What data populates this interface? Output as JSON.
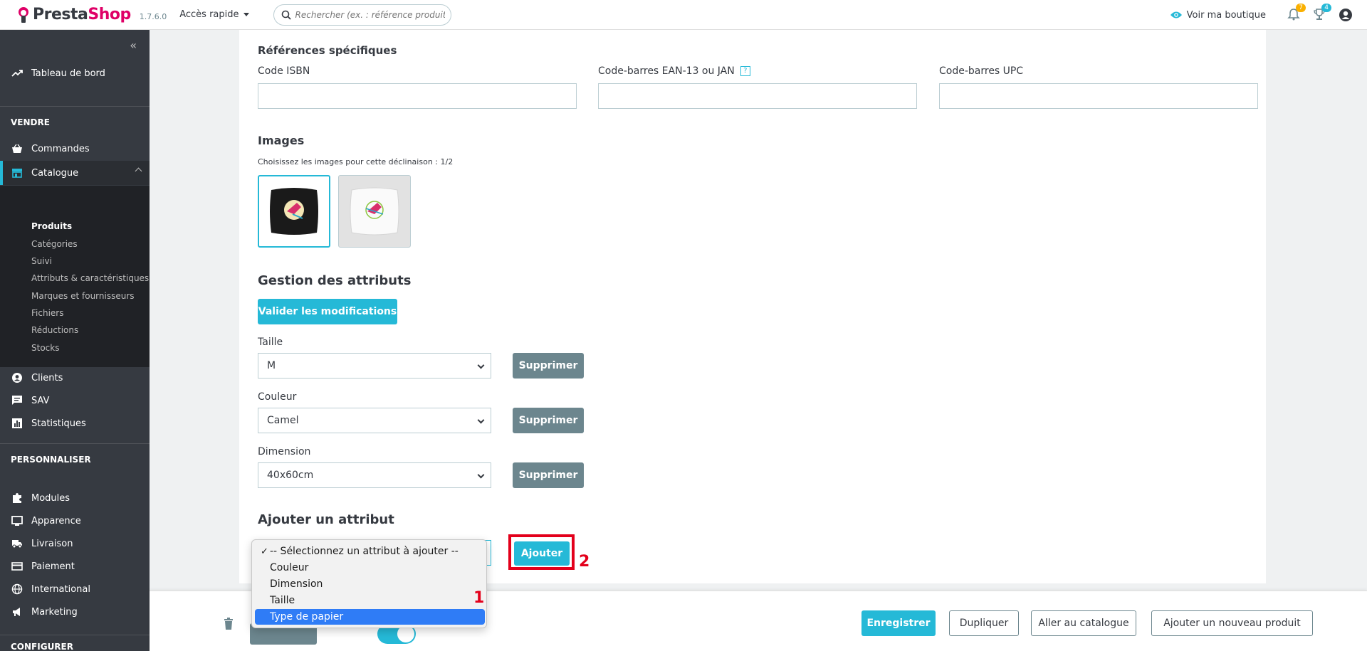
{
  "header": {
    "brand_presta": "Presta",
    "brand_shop": "Shop",
    "version": "1.7.6.0",
    "quick_access": "Accès rapide",
    "search_placeholder": "Rechercher (ex. : référence produit, nom",
    "view_shop": "Voir ma boutique",
    "notif_count": "7",
    "trophy_count": "4"
  },
  "sidebar": {
    "dashboard": "Tableau de bord",
    "section_sell": "VENDRE",
    "orders": "Commandes",
    "catalog": "Catalogue",
    "catalog_sub": [
      "Produits",
      "Catégories",
      "Suivi",
      "Attributs & caractéristiques",
      "Marques et fournisseurs",
      "Fichiers",
      "Réductions",
      "Stocks"
    ],
    "customers": "Clients",
    "sav": "SAV",
    "stats": "Statistiques",
    "section_personalize": "PERSONNALISER",
    "modules": "Modules",
    "appearance": "Apparence",
    "shipping": "Livraison",
    "payment": "Paiement",
    "international": "International",
    "marketing": "Marketing",
    "section_configure": "CONFIGURER"
  },
  "refs": {
    "title": "Références spécifiques",
    "isbn": "Code ISBN",
    "ean": "Code-barres EAN-13 ou JAN",
    "help": "?",
    "upc": "Code-barres UPC"
  },
  "images": {
    "title": "Images",
    "subtitle": "Choisissez les images pour cette déclinaison : 1/2"
  },
  "attributes": {
    "title": "Gestion des attributs",
    "validate": "Valider les modifications",
    "delete": "Supprimer",
    "rows": [
      {
        "label": "Taille",
        "value": "M"
      },
      {
        "label": "Couleur",
        "value": "Camel"
      },
      {
        "label": "Dimension",
        "value": "40x60cm"
      }
    ]
  },
  "add_attribute": {
    "title": "Ajouter un attribut",
    "button": "Ajouter",
    "options": [
      "-- Sélectionnez un attribut à ajouter --",
      "Couleur",
      "Dimension",
      "Taille",
      "Type de papier"
    ],
    "checked_index": 0,
    "highlighted_index": 4,
    "check_mark": "✓"
  },
  "annotations": {
    "one": "1",
    "two": "2"
  },
  "footer": {
    "save": "Enregistrer",
    "duplicate": "Dupliquer",
    "go_catalog": "Aller au catalogue",
    "add_new": "Ajouter un nouveau produit"
  },
  "colors": {
    "accent": "#25b9d7",
    "brand": "#df0067",
    "sidebar": "#363a41",
    "annotation": "#e3001b",
    "highlight": "#2f7cf6"
  }
}
